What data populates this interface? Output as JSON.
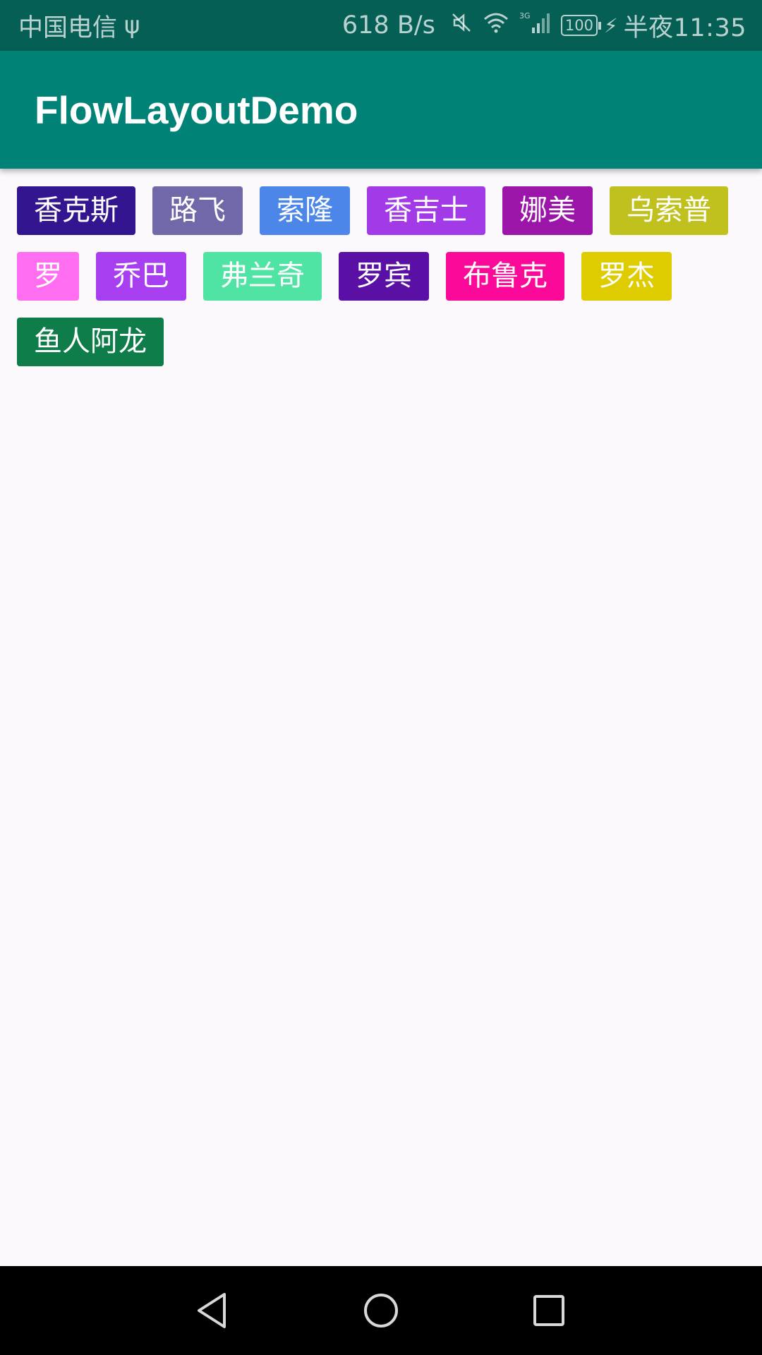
{
  "status_bar": {
    "carrier": "中国电信",
    "usb_icon": "usb-icon",
    "net_speed": "618 B/s",
    "mute_icon": "mute-icon",
    "wifi_icon": "wifi-icon",
    "signal_icon": "signal-3g-icon",
    "battery_level": "100",
    "charging_icon": "charging-icon",
    "time": "半夜11:35"
  },
  "toolbar": {
    "title": "FlowLayoutDemo",
    "background": "#008376"
  },
  "tags": [
    {
      "label": "香克斯",
      "color": "#33168f"
    },
    {
      "label": "路飞",
      "color": "#7068a8"
    },
    {
      "label": "索隆",
      "color": "#4c86e8"
    },
    {
      "label": "香吉士",
      "color": "#a23ae8"
    },
    {
      "label": "娜美",
      "color": "#9a15a8"
    },
    {
      "label": "乌索普",
      "color": "#c0c01e"
    },
    {
      "label": "罗",
      "color": "#ff6ef0"
    },
    {
      "label": "乔巴",
      "color": "#a73ff0"
    },
    {
      "label": "弗兰奇",
      "color": "#4fe3a4"
    },
    {
      "label": "罗宾",
      "color": "#5a0fa5"
    },
    {
      "label": "布鲁克",
      "color": "#fb0a9a"
    },
    {
      "label": "罗杰",
      "color": "#decb00"
    },
    {
      "label": "鱼人阿龙",
      "color": "#0e7d4a"
    }
  ],
  "nav_bar": {
    "back_icon": "back-triangle-icon",
    "home_icon": "home-circle-icon",
    "recents_icon": "recents-square-icon"
  }
}
